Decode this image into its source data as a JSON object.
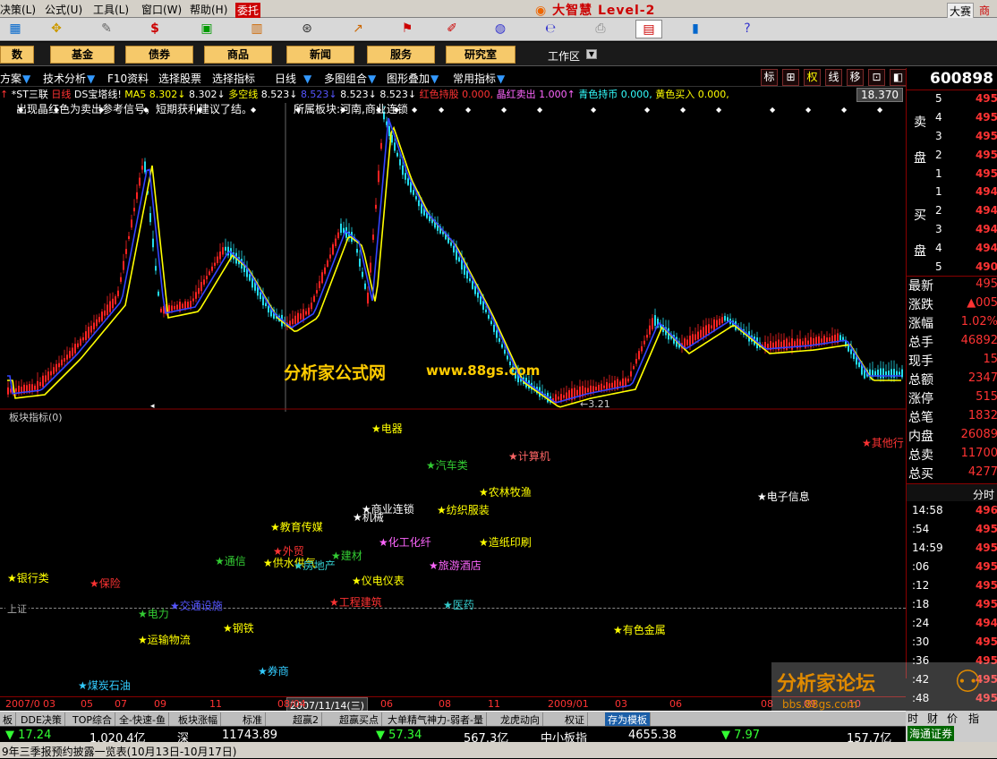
{
  "menubar": {
    "items": [
      "决策(L)",
      "公式(U)",
      "工具(L)",
      "窗口(W)",
      "帮助(H)"
    ],
    "wt_label": "委托",
    "app_title": "大智慧 Level-2",
    "right_labels": [
      "大赛",
      "商"
    ]
  },
  "navbar": {
    "buttons": [
      "数",
      "基金",
      "债券",
      "商品",
      "新闻",
      "服务",
      "研究室"
    ],
    "workarea": "工作区",
    "add_icon": "▼"
  },
  "funcbar": {
    "items": [
      "方案",
      "技术分析",
      "F10资料",
      "选择股票",
      "选择指标",
      "日线",
      "多图组合",
      "图形叠加",
      "常用指标"
    ],
    "view_buttons": [
      "标",
      "⊞",
      "权",
      "线",
      "移",
      "⊡",
      "◧"
    ]
  },
  "chart": {
    "header_parts": [
      {
        "text": "↑ ",
        "color": "#f33"
      },
      {
        "text": "*ST三联 ",
        "color": "#fff"
      },
      {
        "text": "日线 ",
        "color": "#f33"
      },
      {
        "text": "DS宝塔线! ",
        "color": "#fff"
      },
      {
        "text": "MA5  8.302↓ ",
        "color": "#ff0"
      },
      {
        "text": "8.302↓ ",
        "color": "#fff"
      },
      {
        "text": "多空线  ",
        "color": "#ff0"
      },
      {
        "text": "8.523↓ ",
        "color": "#fff"
      },
      {
        "text": "8.523↓ ",
        "color": "#55f"
      },
      {
        "text": "8.523↓ ",
        "color": "#fff"
      },
      {
        "text": "8.523↓ ",
        "color": "#fff"
      },
      {
        "text": "红色持股  0.000, ",
        "color": "#f33"
      },
      {
        "text": "晶红卖出  1.000↑ ",
        "color": "#f6f"
      },
      {
        "text": "青色持币  0.000, ",
        "color": "#3ff"
      },
      {
        "text": "黄色买入  0.000,",
        "color": "#ff0"
      }
    ],
    "price_tag": "18.370",
    "note_left": "出现晶红色为卖出参考信号，短期获利建议了结。",
    "note_right": "所属板块:河南,商业连锁",
    "watermark_cn": "分析家公式网",
    "watermark_url": "www.88gs.com",
    "low_label": "←3.21",
    "cursor_marker": "◂"
  },
  "subchart": {
    "title": "板块指标(0)",
    "index_label": "上证",
    "sectors": [
      {
        "name": "电器",
        "color": "#ff0"
      },
      {
        "name": "计算机",
        "color": "#f66"
      },
      {
        "name": "汽车类",
        "color": "#3c3"
      },
      {
        "name": "农林牧渔",
        "color": "#ff0"
      },
      {
        "name": "电子信息",
        "color": "#fff"
      },
      {
        "name": "其他行",
        "color": "#f33"
      },
      {
        "name": "商业连锁",
        "color": "#fff"
      },
      {
        "name": "纺织服装",
        "color": "#ff0"
      },
      {
        "name": "机械",
        "color": "#fff"
      },
      {
        "name": "教育传媒",
        "color": "#ff0"
      },
      {
        "name": "化工化纤",
        "color": "#f6f"
      },
      {
        "name": "造纸印刷",
        "color": "#ff0"
      },
      {
        "name": "外贸",
        "color": "#f33"
      },
      {
        "name": "建材",
        "color": "#3c3"
      },
      {
        "name": "通信",
        "color": "#3c3"
      },
      {
        "name": "供水供气",
        "color": "#ff0"
      },
      {
        "name": "房地产",
        "color": "#3cc"
      },
      {
        "name": "旅游酒店",
        "color": "#f6f"
      },
      {
        "name": "银行类",
        "color": "#ff0"
      },
      {
        "name": "保险",
        "color": "#f33"
      },
      {
        "name": "仪电仪表",
        "color": "#ff0"
      },
      {
        "name": "交通设施",
        "color": "#55f"
      },
      {
        "name": "工程建筑",
        "color": "#f33"
      },
      {
        "name": "医药",
        "color": "#3cc"
      },
      {
        "name": "电力",
        "color": "#3c3"
      },
      {
        "name": "钢铁",
        "color": "#ff0"
      },
      {
        "name": "有色金属",
        "color": "#ff0"
      },
      {
        "name": "运输物流",
        "color": "#ff0"
      },
      {
        "name": "券商",
        "color": "#3cf"
      },
      {
        "name": "煤炭石油",
        "color": "#3cf"
      }
    ]
  },
  "datebar": {
    "labels": [
      "2007/0",
      "03",
      "05",
      "07",
      "09",
      "11",
      "08/04",
      "06",
      "08",
      "11",
      "2009/01",
      "03",
      "06",
      "08",
      "09",
      "10"
    ],
    "cursor_date": "2007/11/14(三)"
  },
  "quote": {
    "code": "600898",
    "sell_label": [
      "卖",
      "盘"
    ],
    "buy_label": [
      "买",
      "盘"
    ],
    "sell_levels": [
      "5",
      "4",
      "3",
      "2",
      "1"
    ],
    "buy_levels": [
      "1",
      "2",
      "3",
      "4",
      "5"
    ],
    "sell_prices": [
      "495",
      "495",
      "495",
      "495",
      "495"
    ],
    "buy_prices": [
      "494",
      "494",
      "494",
      "494",
      "490"
    ],
    "stats": [
      {
        "label": "最新",
        "value": "495"
      },
      {
        "label": "涨跌",
        "value": "▲005"
      },
      {
        "label": "涨幅",
        "value": "1.02%"
      },
      {
        "label": "总手",
        "value": "46892"
      },
      {
        "label": "现手",
        "value": "15"
      },
      {
        "label": "总额",
        "value": "2347"
      },
      {
        "label": "涨停",
        "value": "515"
      },
      {
        "label": "总笔",
        "value": "1832"
      },
      {
        "label": "内盘",
        "value": "26089"
      },
      {
        "label": "总卖",
        "value": "11700"
      },
      {
        "label": "总买",
        "value": "4277"
      }
    ],
    "ticks_header": "分时",
    "ticks": [
      {
        "time": "14:58",
        "price": "496"
      },
      {
        "time": ":54",
        "price": "495"
      },
      {
        "time": "14:59",
        "price": "495"
      },
      {
        "time": ":06",
        "price": "495"
      },
      {
        "time": ":12",
        "price": "495"
      },
      {
        "time": ":18",
        "price": "495"
      },
      {
        "time": ":24",
        "price": "494"
      },
      {
        "time": ":30",
        "price": "495"
      },
      {
        "time": ":36",
        "price": "495"
      },
      {
        "time": ":42",
        "price": "495"
      },
      {
        "time": ":48",
        "price": "495"
      }
    ]
  },
  "tabbar": {
    "tabs": [
      "板",
      "DDE决策",
      "TOP综合",
      "全-快速-鱼",
      "板块涨幅",
      "标准",
      "超赢2",
      "超赢买点",
      "大单精气神力-弱者-量",
      "龙虎动向",
      "权证",
      "存为模板"
    ]
  },
  "statusbar": {
    "items": [
      {
        "text": "▼ 17.24",
        "color": "#3f3"
      },
      {
        "text": "1,020.4亿",
        "color": "#fff"
      },
      {
        "text": "深",
        "color": "#fff"
      },
      {
        "text": "11743.89",
        "color": "#fff"
      },
      {
        "text": "▼ 57.34",
        "color": "#3f3"
      },
      {
        "text": "567.3亿",
        "color": "#fff"
      },
      {
        "text": "中小板指",
        "color": "#fff"
      },
      {
        "text": "4655.38",
        "color": "#fff"
      },
      {
        "text": "▼ 7.97",
        "color": "#3f3"
      },
      {
        "text": "157.7亿",
        "color": "#fff"
      }
    ],
    "right_labels": [
      "时",
      "财",
      "价",
      "指",
      "海通",
      "证券"
    ]
  },
  "ticker": "9年三季报预约披露一览表(10月13日-10月17日)",
  "forum": {
    "title": "分析家论坛",
    "url": "bbs.88gs.com"
  }
}
